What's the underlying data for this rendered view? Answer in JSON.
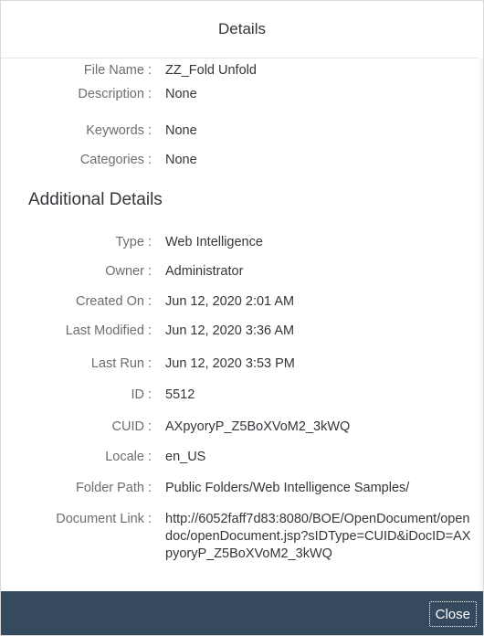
{
  "dialog": {
    "title": "Details",
    "close_label": "Close"
  },
  "general": [
    {
      "label": "File Name :",
      "value": "ZZ_Fold Unfold"
    },
    {
      "label": "Description :",
      "value": "None"
    },
    {
      "label": "Keywords :",
      "value": "None"
    },
    {
      "label": "Categories :",
      "value": "None"
    }
  ],
  "additional": {
    "title": "Additional Details",
    "rows": [
      {
        "label": "Type :",
        "value": "Web Intelligence"
      },
      {
        "label": "Owner :",
        "value": "Administrator"
      },
      {
        "label": "Created On :",
        "value": "Jun 12, 2020 2:01 AM"
      },
      {
        "label": "Last Modified :",
        "value": "Jun 12, 2020 3:36 AM"
      },
      {
        "label": "Last Run :",
        "value": "Jun 12, 2020 3:53 PM"
      },
      {
        "label": "ID :",
        "value": "5512"
      },
      {
        "label": "CUID :",
        "value": "AXpyoryP_Z5BoXVoM2_3kWQ"
      },
      {
        "label": "Locale :",
        "value": "en_US"
      },
      {
        "label": "Folder Path :",
        "value": "Public Folders/Web Intelligence Samples/"
      },
      {
        "label": "Document Link :",
        "value": "http://6052faff7d83:8080/BOE/OpenDocument/opendoc/openDocument.jsp?sIDType=CUID&iDocID=AXpyoryP_Z5BoXVoM2_3kWQ"
      }
    ]
  },
  "colors": {
    "footer_background": "#354a5f",
    "label_text": "#6a6d70",
    "value_text": "#32363a"
  }
}
